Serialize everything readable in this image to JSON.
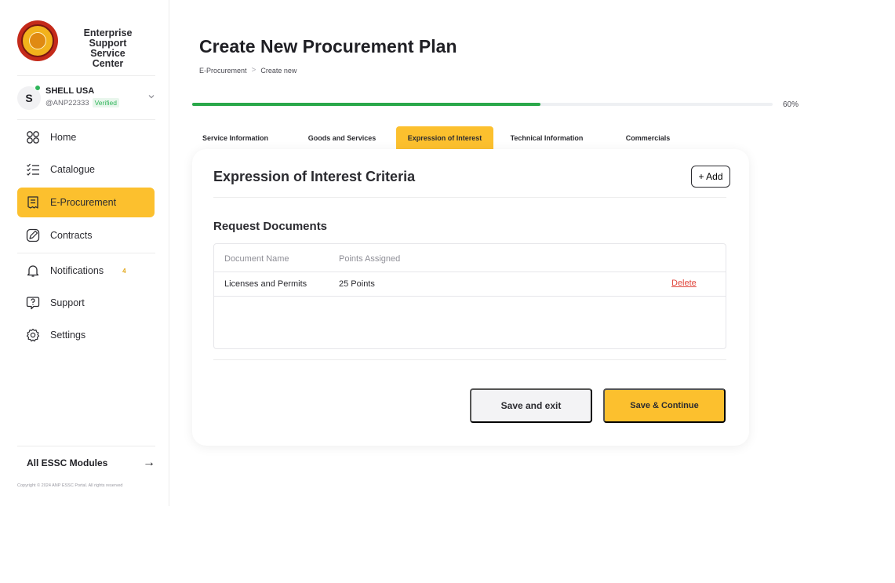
{
  "colors": {
    "accent": "#fcc02e",
    "progress": "#2aa84a",
    "online": "#2fb55a",
    "danger": "#e0463c"
  },
  "brand": {
    "line1": "Enterprise",
    "line2": "Support Service",
    "line3": "Center",
    "logo_icon": "organization-seal-logo"
  },
  "account": {
    "initial": "S",
    "name": "SHELL USA",
    "handle": "@ANP22333",
    "verified": "Verified",
    "chevron_icon": "chevron-down-icon"
  },
  "nav": {
    "home": {
      "label": "Home",
      "icon": "grid-icon"
    },
    "catalogue": {
      "label": "Catalogue",
      "icon": "list-check-icon"
    },
    "eprocurement": {
      "label": "E-Procurement",
      "icon": "document-list-icon"
    },
    "contracts": {
      "label": "Contracts",
      "icon": "pen-icon"
    },
    "notifications": {
      "label": "Notifications",
      "badge": "4",
      "icon": "bell-icon"
    },
    "support": {
      "label": "Support",
      "icon": "help-chat-icon"
    },
    "settings": {
      "label": "Settings",
      "icon": "gear-icon"
    }
  },
  "footer": {
    "modules": "All ESSC Modules",
    "arrow": "→",
    "copyright": "Copyright © 2024 ANP ESSC Portal. All rights reserved"
  },
  "page": {
    "title": "Create New Procurement Plan",
    "breadcrumb": {
      "root": "E-Procurement",
      "current": "Create new",
      "separator": ">"
    }
  },
  "progress": {
    "percent": 60,
    "label": "60%"
  },
  "tabs": {
    "service_info": "Service Information",
    "goods_services": "Goods and Services",
    "eoi": "Expression of Interest",
    "technical": "Technical Information",
    "commercials": "Commercials",
    "active": "Expression of Interest"
  },
  "card": {
    "title": "Expression of Interest Criteria",
    "add_label": "+ Add",
    "section_title": "Request Documents",
    "table": {
      "headers": {
        "name": "Document Name",
        "points": "Points Assigned"
      },
      "rows": [
        {
          "name": "Licenses and Permits",
          "points": "25 Points",
          "action": "Delete"
        }
      ]
    },
    "buttons": {
      "exit": "Save and exit",
      "continue": "Save & Continue"
    }
  }
}
